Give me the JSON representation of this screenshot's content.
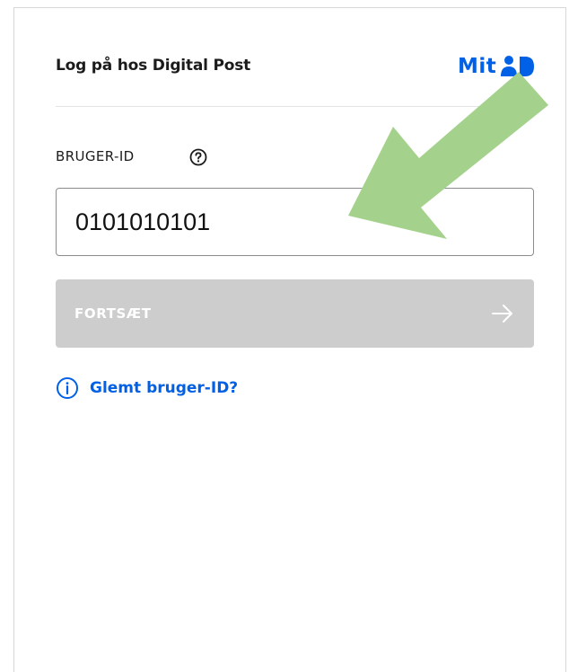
{
  "header": {
    "title": "Log på hos Digital Post",
    "brand_text": "Mit",
    "brand_color": "#0060e6"
  },
  "form": {
    "userid_label": "BRUGER-ID",
    "help_icon": "question-circle-icon",
    "userid_value": "0101010101",
    "continue_label": "FORTSÆT",
    "continue_icon": "arrow-right-icon",
    "continue_enabled": false,
    "forgot_icon": "info-circle-icon",
    "forgot_label": "Glemt bruger-ID?"
  },
  "annotation": {
    "arrow_color": "#a4d28c",
    "arrow_icon": "pointer-arrow-icon"
  }
}
